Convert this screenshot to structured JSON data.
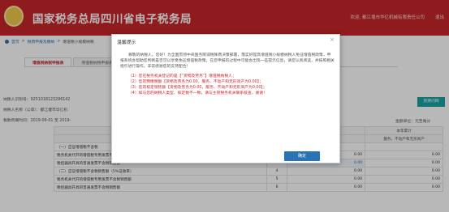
{
  "header": {
    "title": "国家税务总局四川省电子税务局",
    "welcome": "欢迎, 都江堰市华亿机械有限责任公司",
    "logout": "退出"
  },
  "breadcrumb": {
    "home": "首页",
    "sep": ">",
    "items": [
      "税费申报及缴纳",
      "增值税小规模纳税"
    ]
  },
  "tabs": [
    {
      "label": "增值税纳税申报表",
      "active": true
    },
    {
      "label": "增值税纳税申报表附列资料",
      "active": false
    }
  ],
  "taxpayer": {
    "id_label": "纳税人识别号：9251018123296142",
    "name_label": "纳税人名称（公章）：都江堰市华亿机",
    "period_label": "税款所属时间：2019-06-01 至 2019-"
  },
  "unit_note": "金额单位：元至角分",
  "side_button": "我要问网",
  "grid": {
    "header": [
      "",
      "",
      "",
      "本年累计"
    ],
    "subheader": [
      "",
      "",
      "服务",
      "服务、不动产和无形资产"
    ],
    "rows": [
      {
        "label": "（一）应征增值税不含税",
        "num": "",
        "v1": "",
        "v2": ""
      },
      {
        "label": "税务机关代开的增值税专用发票不含税销售额",
        "num": "2",
        "v1": "0.00",
        "v2": "0.00"
      },
      {
        "label": "税控器具开具的普通发票不含税销售额",
        "num": "3",
        "v1": "0.00",
        "v2": "0.00"
      },
      {
        "label": "（二）应征增值税不含税销售额（5%征收率）",
        "num": "4",
        "v1": "0.00",
        "v2": "0.00"
      },
      {
        "label": "税务机关代开的增值税专用发票不含税销售额",
        "num": "5",
        "v1": "0.00",
        "v2": "0.00"
      },
      {
        "label": "税控器具开具的普通发票不含税销售额",
        "num": "6",
        "v1": "0.00",
        "v2": "0.00"
      }
    ]
  },
  "modal": {
    "title": "温馨提示",
    "close": "×",
    "intro": "尊敬的纳税人，您好！为全面贯彻中央国务院减税降费决策部署，落实好提高增值税小规模纳税人免征增值税政策，申报系统会帮助您判断是否可以享受免征增值税政策。在您申报的过程中可能会出现一些提示信息，请您认真阅读，并按照相关指引进行操作，非常感谢您的支持配合！",
    "items": [
      "（1）您在税务机关登记的是【“货物及劳务”】增值税纳税人；",
      "（2）您的预缴税额【货物及劳务为0.00，服务、不动产和无形资产为0.00】；",
      "（3）您的核定销售额【货物及劳务为0.00，服务、不动产和无形资产为0.00】；",
      "（4）如与您的纳税人类型、核定数不一致，请与主管税务机关联系核查，谢谢！"
    ],
    "ok": "确定"
  },
  "colors": {
    "brand_red": "#c8262a",
    "link_blue": "#2a73b6",
    "side_teal": "#1aa3a3"
  }
}
